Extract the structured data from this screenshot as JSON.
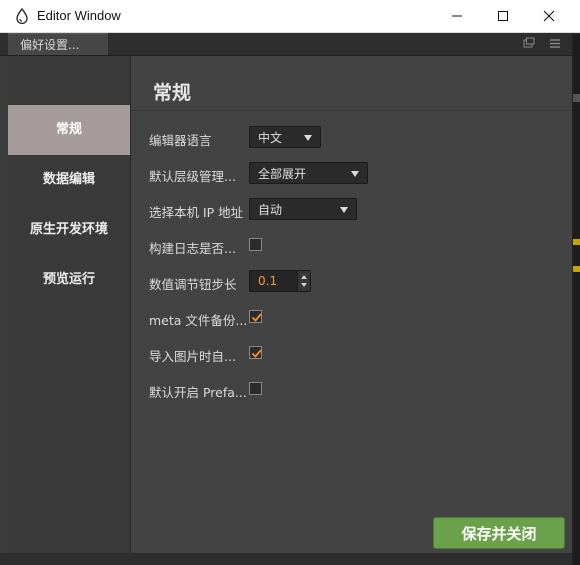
{
  "window": {
    "title": "Editor Window",
    "minimize_glyph": "—",
    "maximize_glyph": "☐",
    "close_glyph": "✕"
  },
  "tab": {
    "label": "偏好设置..."
  },
  "sidebar": {
    "items": [
      {
        "label": "常规",
        "active": true
      },
      {
        "label": "数据编辑",
        "active": false
      },
      {
        "label": "原生开发环境",
        "active": false
      },
      {
        "label": "预览运行",
        "active": false
      }
    ]
  },
  "content": {
    "heading": "常规",
    "rows": [
      {
        "label": "编辑器语言",
        "type": "select",
        "value": "中文"
      },
      {
        "label": "默认层级管理...",
        "type": "select",
        "value": "全部展开"
      },
      {
        "label": "选择本机 IP 地址",
        "type": "select",
        "value": "自动"
      },
      {
        "label": "构建日志是否...",
        "type": "checkbox",
        "checked": false
      },
      {
        "label": "数值调节钮步长",
        "type": "number",
        "value": "0.1"
      },
      {
        "label": "meta 文件备份...",
        "type": "checkbox",
        "checked": true
      },
      {
        "label": "导入图片时自...",
        "type": "checkbox",
        "checked": true
      },
      {
        "label": "默认开启 Prefa...",
        "type": "checkbox",
        "checked": false
      }
    ]
  },
  "footer": {
    "save_label": "保存并关闭"
  },
  "colors": {
    "accent_check": "#f08a24",
    "save_button": "#6aa14a",
    "active_sidebar": "#a59b9b",
    "number_value": "#f39b3a"
  }
}
